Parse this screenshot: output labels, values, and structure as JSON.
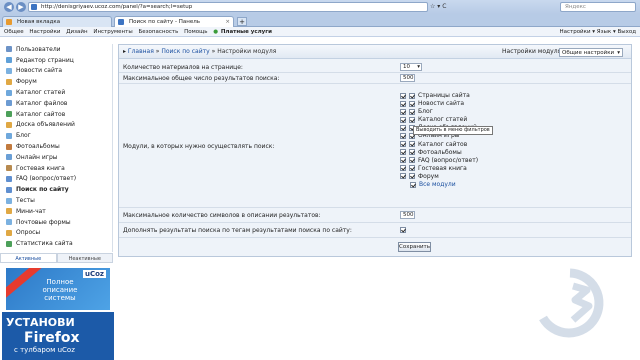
{
  "browser": {
    "url": "http://denisgriyaev.ucoz.com/panel/?a=search;l=setup",
    "search_placeholder": "Яндекс",
    "url_buttons": "☆ ▾ C",
    "tabs": [
      {
        "label": "Новая вкладка"
      },
      {
        "label": "Поиск по сайту - Панель управлен..."
      }
    ],
    "bookmarks": [
      "Общее",
      "Настройки",
      "Дизайн",
      "Инструменты",
      "Безопасность",
      "Помощь"
    ],
    "paid_services": "Платные услуги",
    "right_items": "Настройки ▾   Язык ▾   Выход"
  },
  "sidebar": {
    "items": [
      {
        "label": "Пользователи",
        "icon": "users-icon",
        "color": "#6d93c7"
      },
      {
        "label": "Редактор страниц",
        "icon": "page-icon",
        "color": "#5fa0d8"
      },
      {
        "label": "Новости сайта",
        "icon": "news-icon",
        "color": "#7bb1e0"
      },
      {
        "label": "Форум",
        "icon": "forum-icon",
        "color": "#e0a844"
      },
      {
        "label": "Каталог статей",
        "icon": "articles-icon",
        "color": "#6fa8dc"
      },
      {
        "label": "Каталог файлов",
        "icon": "files-icon",
        "color": "#6c9bd2"
      },
      {
        "label": "Каталог сайтов",
        "icon": "sites-icon",
        "color": "#4da05a"
      },
      {
        "label": "Доска объявлений",
        "icon": "board-icon",
        "color": "#e0a844"
      },
      {
        "label": "Блог",
        "icon": "blog-icon",
        "color": "#6fa8dc"
      },
      {
        "label": "Фотоальбомы",
        "icon": "photo-icon",
        "color": "#c27a3e"
      },
      {
        "label": "Онлайн игры",
        "icon": "games-icon",
        "color": "#6a9fd6"
      },
      {
        "label": "Гостевая книга",
        "icon": "guestbook-icon",
        "color": "#b78a4f"
      },
      {
        "label": "FAQ (вопрос/ответ)",
        "icon": "faq-icon",
        "color": "#5f8fd0"
      },
      {
        "label": "Поиск по сайту",
        "icon": "search-icon",
        "color": "#5f8fd0"
      },
      {
        "label": "Тесты",
        "icon": "tests-icon",
        "color": "#7bb1e0"
      },
      {
        "label": "Мини-чат",
        "icon": "chat-icon",
        "color": "#e0a844"
      },
      {
        "label": "Почтовые формы",
        "icon": "mail-icon",
        "color": "#7bb1e0"
      },
      {
        "label": "Опросы",
        "icon": "poll-icon",
        "color": "#e0a844"
      },
      {
        "label": "Статистика сайта",
        "icon": "stats-icon",
        "color": "#4da05a"
      }
    ],
    "active_index": 13,
    "tabs": [
      "Активные",
      "Неактивные"
    ]
  },
  "promo": {
    "ribbon_logo": "uCoz",
    "text1": "Полное описание системы",
    "line1": "УСТАНОВИ",
    "line2": "Firefox",
    "line3": "с тулбаром uCoz"
  },
  "panel": {
    "breadcrumb": {
      "home": "Главная",
      "section": "Поиск по сайту",
      "current": "Настройки модуля"
    },
    "module_settings_label": "Настройки модуля:",
    "module_settings_value": "Общие настройки",
    "rows": {
      "materials_per_page_label": "Количество материалов на странице:",
      "materials_per_page_value": "10",
      "max_results_label": "Максимальное общее число результатов поиска:",
      "max_results_value": "500",
      "modules_label": "Модули, в которых нужно осуществлять поиск:",
      "max_chars_label": "Максимальное количество символов в описании результатов:",
      "max_chars_value": "500",
      "tags_label": "Дополнять результаты поиска по тегам результатами поиска по сайту:"
    },
    "modules": [
      "Страницы сайта",
      "Новости сайта",
      "Блог",
      "Каталог статей",
      "Доска объявлений",
      "Онлайн игры",
      "Каталог сайтов",
      "Фотоальбомы",
      "FAQ (вопрос/ответ)",
      "Гостевая книга",
      "Форум"
    ],
    "all_modules": "Все модули",
    "tooltip": "Выводить в меню фильтров",
    "save_label": "Сохранить"
  }
}
